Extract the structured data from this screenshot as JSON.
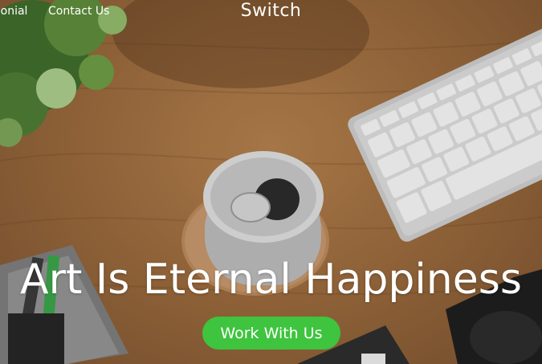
{
  "nav": {
    "links": [
      {
        "label": "monial"
      },
      {
        "label": "Contact Us"
      }
    ],
    "brand": "Switch"
  },
  "hero": {
    "headline": "Art Is Eternal Happiness",
    "cta_label": "Work With Us",
    "background_description_icon": "desk-photo"
  },
  "colors": {
    "cta": "#3ec43e",
    "text": "#ffffff",
    "desk": "#a5723f"
  }
}
